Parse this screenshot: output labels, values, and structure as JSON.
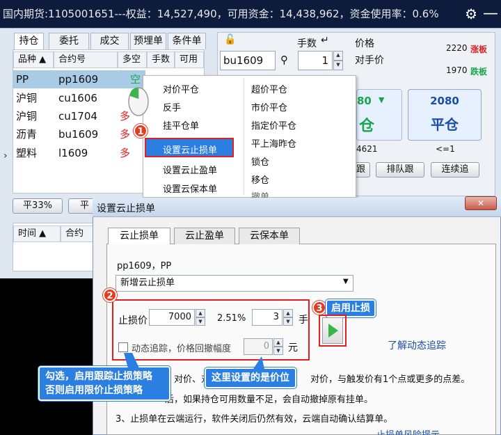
{
  "topbar": {
    "text": "国内期货:1105001651---权益：14,527,490，可用资金：14,438,962，资金使用率：0.6%",
    "gear_glyph": "⚙",
    "minimize_glyph": "—"
  },
  "tabs": [
    "持仓",
    "委托",
    "成交",
    "预埋单",
    "条件单"
  ],
  "grid": {
    "headers": [
      "品种 ▲",
      "合约号",
      "多空",
      "手数",
      "可用"
    ],
    "rows": [
      {
        "name": "PP",
        "code": "pp1609",
        "dir": "空"
      },
      {
        "name": "沪铜",
        "code": "cu1606",
        "dir": ""
      },
      {
        "name": "沪铜",
        "code": "cu1704",
        "dir": "多"
      },
      {
        "name": "沥青",
        "code": "bu1609",
        "dir": "多"
      },
      {
        "name": "塑料",
        "code": "l1609",
        "dir": "多"
      }
    ]
  },
  "left_buttons": {
    "flat33": "平33%",
    "flat_partial": "平"
  },
  "lower_grid_headers": [
    "时间 ▲",
    "合约"
  ],
  "order_panel": {
    "lock_glyph": "🔓",
    "lots_label": "手数",
    "price_label": "价格",
    "contract_value": "bu1609",
    "lots_value": "1",
    "price_value": "对手价",
    "limit_up_value": "2220",
    "limit_up_label": "涨板",
    "limit_down_value": "1970",
    "limit_down_label": "跌板",
    "card1_price": "80",
    "card1_label": "仓",
    "card2_price": "2080",
    "card2_label": "平仓",
    "qty_left": "4621",
    "qty_right": "<=1",
    "btn_queue": "排队跟",
    "btn_continuous": "连续追",
    "btn_partial": "跟"
  },
  "context_menu": {
    "left": [
      "对价平仓",
      "反手",
      "挂平仓单",
      "设置云止损单",
      "设置云止盈单",
      "设置云保本单"
    ],
    "right": [
      "超价平仓",
      "市价平仓",
      "指定价平仓",
      "平上海昨仓",
      "锁仓",
      "移仓",
      "撤单"
    ]
  },
  "dialog": {
    "title": "设置云止损单",
    "close_glyph": "✕",
    "tabs": [
      "云止损单",
      "云止盈单",
      "云保本单"
    ],
    "contract_label": "pp1609，PP",
    "dropdown_value": "新增云止损单",
    "stop_price_label": "止损价",
    "stop_price_value": "7000",
    "percent_value": "2.51%",
    "lots_value": "3",
    "lots_unit": "手",
    "trailing_label": "动态追踪，价格回撤幅度",
    "trailing_value": "0",
    "trailing_unit": "元",
    "learn_link": "了解动态追踪",
    "line1": "、对价、对手价",
    "line1_right": "对价，与触发价有1个点或更多的点差。",
    "line2": "后，如果持仓可用数量不足，会自动撤掉原有挂单。",
    "line3": "3、止损单在云端运行，软件关闭后仍然有效，云端自动确认结算单。",
    "line4_right": "止损单风险提示"
  },
  "annotations": {
    "badge1": "1",
    "badge2": "2",
    "badge3": "3",
    "enable_label": "启用止损",
    "callout_left": "勾选，启用跟踪止损策略\n否则启用限价止损策略",
    "callout_right": "这里设置的是价位"
  },
  "colors": {
    "accent_blue": "#2b7fe0",
    "annotation_red": "#e02020",
    "topbar_bg": "#0d1b3d"
  }
}
